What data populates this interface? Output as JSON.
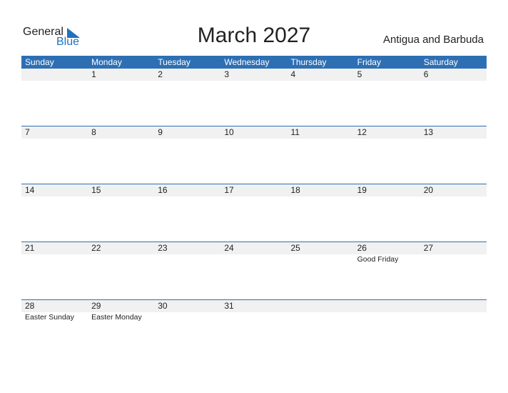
{
  "logo": {
    "general": "General",
    "blue": "Blue"
  },
  "title": "March 2027",
  "country": "Antigua and Barbuda",
  "colors": {
    "accent": "#2e6fb3",
    "row_bg": "#f1f1f1"
  },
  "weekdays": [
    "Sunday",
    "Monday",
    "Tuesday",
    "Wednesday",
    "Thursday",
    "Friday",
    "Saturday"
  ],
  "weeks": [
    {
      "days": [
        "",
        "1",
        "2",
        "3",
        "4",
        "5",
        "6"
      ],
      "events": [
        "",
        "",
        "",
        "",
        "",
        "",
        ""
      ]
    },
    {
      "days": [
        "7",
        "8",
        "9",
        "10",
        "11",
        "12",
        "13"
      ],
      "events": [
        "",
        "",
        "",
        "",
        "",
        "",
        ""
      ]
    },
    {
      "days": [
        "14",
        "15",
        "16",
        "17",
        "18",
        "19",
        "20"
      ],
      "events": [
        "",
        "",
        "",
        "",
        "",
        "",
        ""
      ]
    },
    {
      "days": [
        "21",
        "22",
        "23",
        "24",
        "25",
        "26",
        "27"
      ],
      "events": [
        "",
        "",
        "",
        "",
        "",
        "Good Friday",
        ""
      ]
    },
    {
      "days": [
        "28",
        "29",
        "30",
        "31",
        "",
        "",
        ""
      ],
      "events": [
        "Easter Sunday",
        "Easter Monday",
        "",
        "",
        "",
        "",
        ""
      ]
    }
  ]
}
